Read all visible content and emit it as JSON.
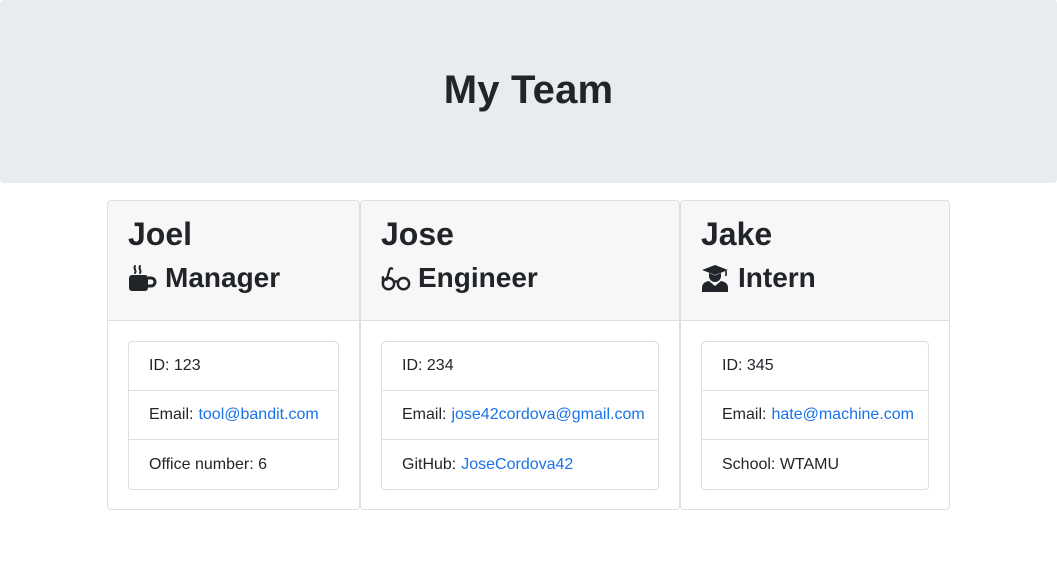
{
  "header": {
    "title": "My Team"
  },
  "employees": [
    {
      "name": "Joel",
      "role": "Manager",
      "icon": "coffee-icon",
      "id_label": "ID: 123",
      "email_label": "Email:",
      "email": "tool@bandit.com",
      "extra_label": "Office number: 6"
    },
    {
      "name": "Jose",
      "role": "Engineer",
      "icon": "glasses-icon",
      "id_label": "ID: 234",
      "email_label": "Email:",
      "email": "jose42cordova@gmail.com",
      "extra_prefix": "GitHub:",
      "extra_link": "JoseCordova42"
    },
    {
      "name": "Jake",
      "role": "Intern",
      "icon": "graduate-icon",
      "id_label": "ID: 345",
      "email_label": "Email:",
      "email": "hate@machine.com",
      "extra_label": "School: WTAMU"
    }
  ],
  "colors": {
    "link": "#1a73e8",
    "jumbotron_bg": "#e9ecef",
    "card_header_bg": "#f7f7f7"
  }
}
